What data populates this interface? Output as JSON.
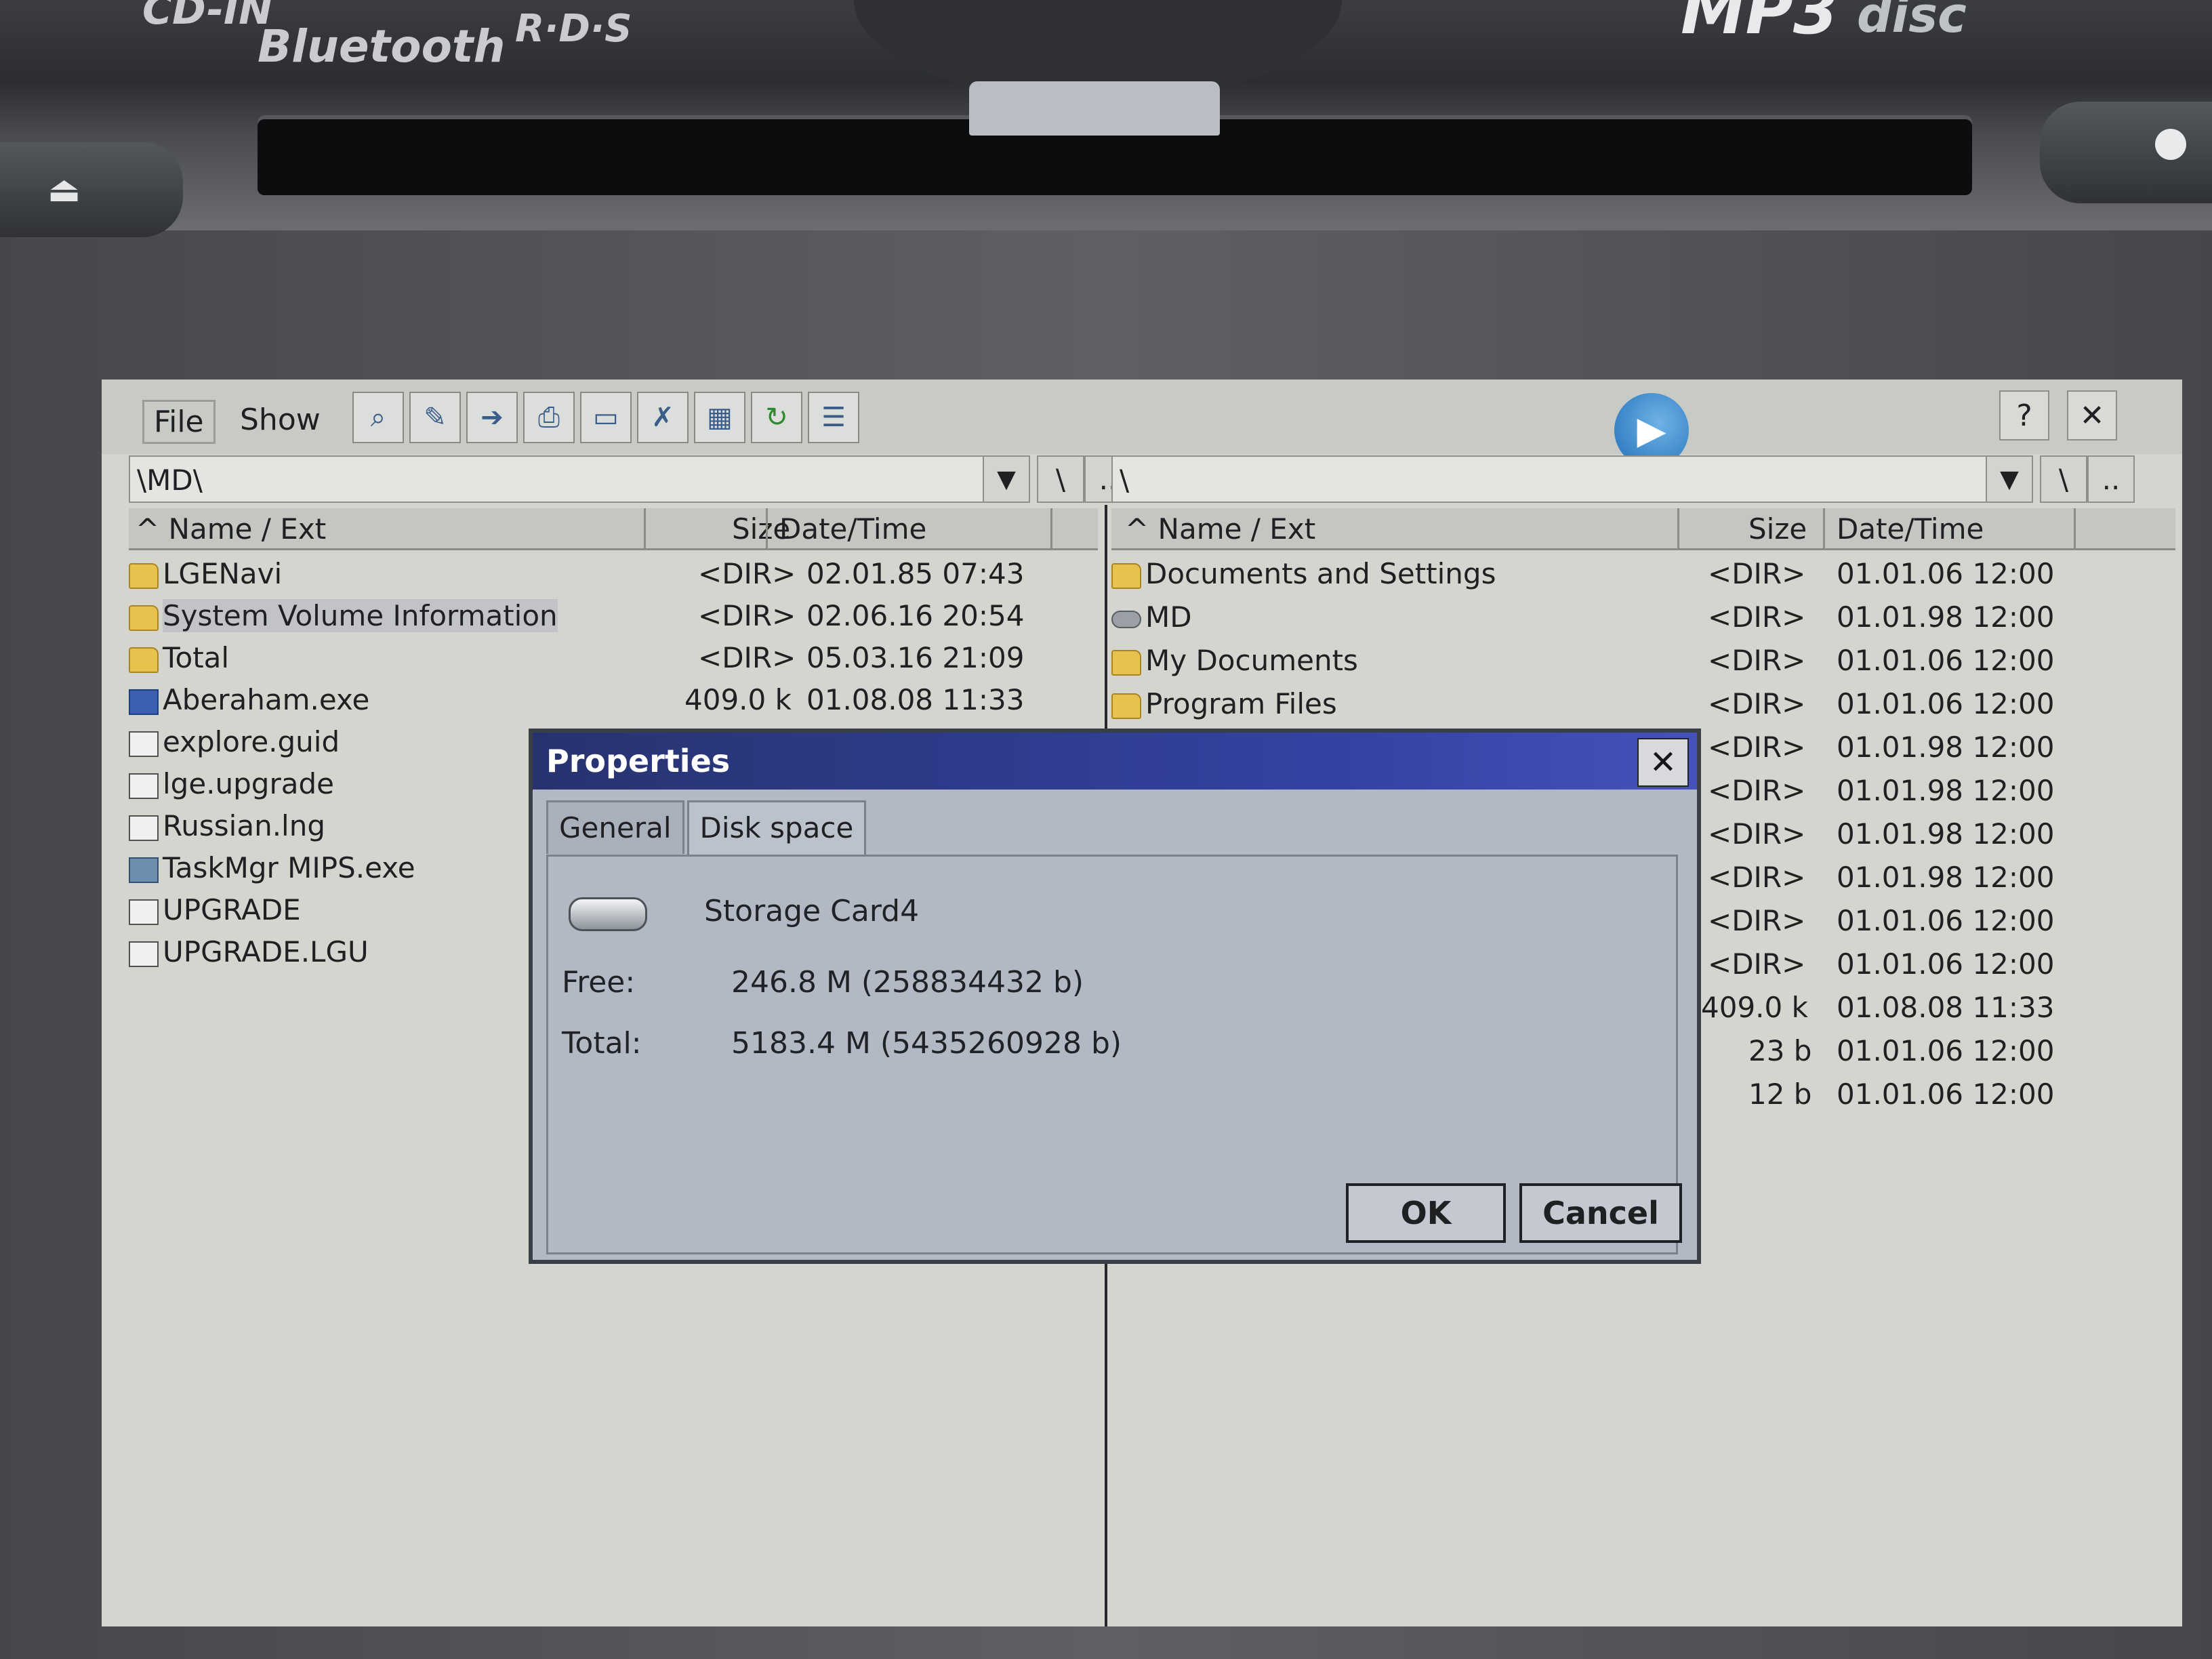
{
  "device": {
    "brand_cd": "CD-IN",
    "brand_bluetooth": "Bluetooth",
    "brand_rds": "R·D·S",
    "brand_mp3": "MP3",
    "brand_disc": "disc"
  },
  "toolbar": {
    "menu_file": "File",
    "menu_show": "Show",
    "icons": [
      "search-icon",
      "find-file-icon",
      "move-icon",
      "print-icon",
      "new-folder-icon",
      "delete-icon",
      "view-grid-icon",
      "refresh-icon",
      "properties-icon"
    ],
    "help_label": "?",
    "close_label": "✕"
  },
  "left_panel": {
    "path": "\\MD\\",
    "root_btn": "\\",
    "up_btn": "..",
    "headers": {
      "name": "^ Name / Ext",
      "size": "Size",
      "date": "Date/Time"
    },
    "rows": [
      {
        "name": "LGENavi",
        "size": "<DIR>",
        "date": "02.01.85 07:43",
        "icon": "folder"
      },
      {
        "name": "System Volume Information",
        "size": "<DIR>",
        "date": "02.06.16 20:54",
        "icon": "folder"
      },
      {
        "name": "Total",
        "size": "<DIR>",
        "date": "05.03.16 21:09",
        "icon": "folder"
      },
      {
        "name": "Aberaham.exe",
        "size": "409.0 k",
        "date": "01.08.08 11:33",
        "icon": "exe"
      },
      {
        "name": "explore.guid",
        "size": "",
        "date": "",
        "icon": "doc"
      },
      {
        "name": "lge.upgrade",
        "size": "",
        "date": "",
        "icon": "doc"
      },
      {
        "name": "Russian.lng",
        "size": "",
        "date": "",
        "icon": "doc"
      },
      {
        "name": "TaskMgr MIPS.exe",
        "size": "",
        "date": "",
        "icon": "task"
      },
      {
        "name": "UPGRADE",
        "size": "",
        "date": "",
        "icon": "doc"
      },
      {
        "name": "UPGRADE.LGU",
        "size": "",
        "date": "",
        "icon": "doc"
      }
    ]
  },
  "right_panel": {
    "path": "\\",
    "root_btn": "\\",
    "up_btn": "..",
    "headers": {
      "name": "^ Name / Ext",
      "size": "Size",
      "date": "Date/Time"
    },
    "rows": [
      {
        "name": "Documents and Settings",
        "size": "<DIR>",
        "date": "01.01.06 12:00",
        "icon": "folder"
      },
      {
        "name": "MD",
        "size": "<DIR>",
        "date": "01.01.98 12:00",
        "icon": "drive"
      },
      {
        "name": "My Documents",
        "size": "<DIR>",
        "date": "01.01.06 12:00",
        "icon": "folder"
      },
      {
        "name": "Program Files",
        "size": "<DIR>",
        "date": "01.01.06 12:00",
        "icon": "folder"
      },
      {
        "name": "",
        "size": "<DIR>",
        "date": "01.01.98 12:00",
        "icon": ""
      },
      {
        "name": "",
        "size": "<DIR>",
        "date": "01.01.98 12:00",
        "icon": ""
      },
      {
        "name": "",
        "size": "<DIR>",
        "date": "01.01.98 12:00",
        "icon": ""
      },
      {
        "name": "",
        "size": "<DIR>",
        "date": "01.01.98 12:00",
        "icon": ""
      },
      {
        "name": "",
        "size": "<DIR>",
        "date": "01.01.06 12:00",
        "icon": ""
      },
      {
        "name": "",
        "size": "<DIR>",
        "date": "01.01.06 12:00",
        "icon": ""
      },
      {
        "name": "",
        "size": "409.0 k",
        "date": "01.08.08 11:33",
        "icon": ""
      },
      {
        "name": "",
        "size": "23 b",
        "date": "01.01.06 12:00",
        "icon": ""
      },
      {
        "name": "",
        "size": "12 b",
        "date": "01.01.06 12:00",
        "icon": ""
      }
    ]
  },
  "dialog": {
    "title": "Properties",
    "close_label": "✕",
    "tabs": [
      "General",
      "Disk space"
    ],
    "active_tab": "Disk space",
    "drive_name": "Storage Card4",
    "free_label": "Free:",
    "free_value": "246.8 M (258834432 b)",
    "total_label": "Total:",
    "total_value": "5183.4 M (5435260928 b)",
    "ok_label": "OK",
    "cancel_label": "Cancel"
  }
}
